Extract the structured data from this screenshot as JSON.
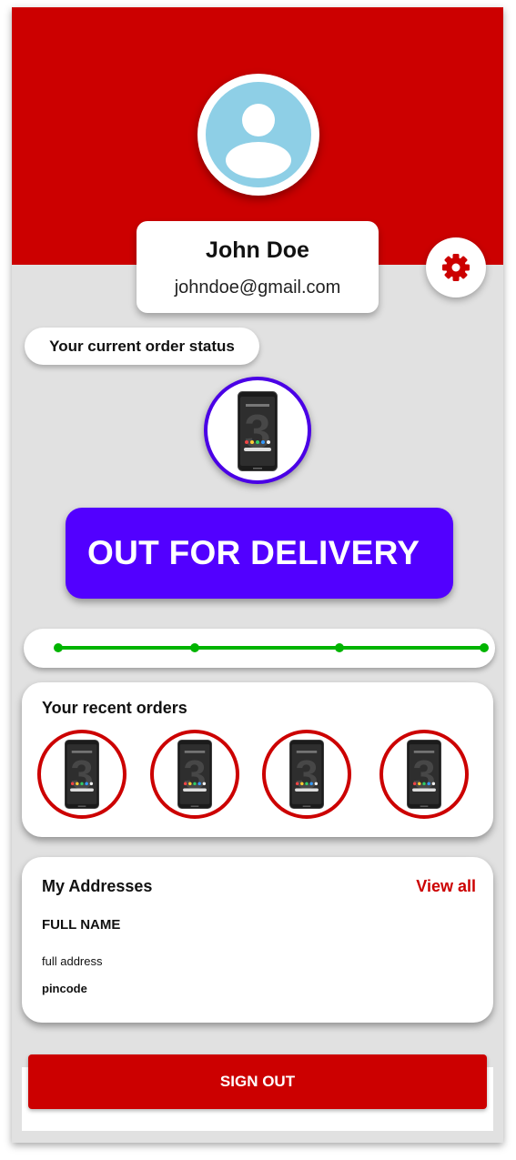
{
  "profile": {
    "name": "John Doe",
    "email": "johndoe@gmail.com",
    "avatar_icon": "user-avatar-icon"
  },
  "settings": {
    "icon": "gear-icon"
  },
  "order_status": {
    "label": "Your current order status",
    "status_text": "OUT FOR DELIVERY",
    "product_icon": "phone-product-image",
    "tracker_steps": 4,
    "tracker_progress": 1.0
  },
  "recent_orders": {
    "title": "Your recent orders",
    "items": [
      {
        "icon": "phone-product-image"
      },
      {
        "icon": "phone-product-image"
      },
      {
        "icon": "phone-product-image"
      },
      {
        "icon": "phone-product-image"
      }
    ]
  },
  "addresses": {
    "title": "My Addresses",
    "view_all_label": "View all",
    "full_name": "FULL NAME",
    "full_address": "full address",
    "pincode": "pincode"
  },
  "signout": {
    "label": "SIGN OUT"
  },
  "colors": {
    "brand_red": "#cc0000",
    "status_purple": "#5200ff",
    "progress_green": "#00b400",
    "background_gray": "#e1e1e1"
  }
}
